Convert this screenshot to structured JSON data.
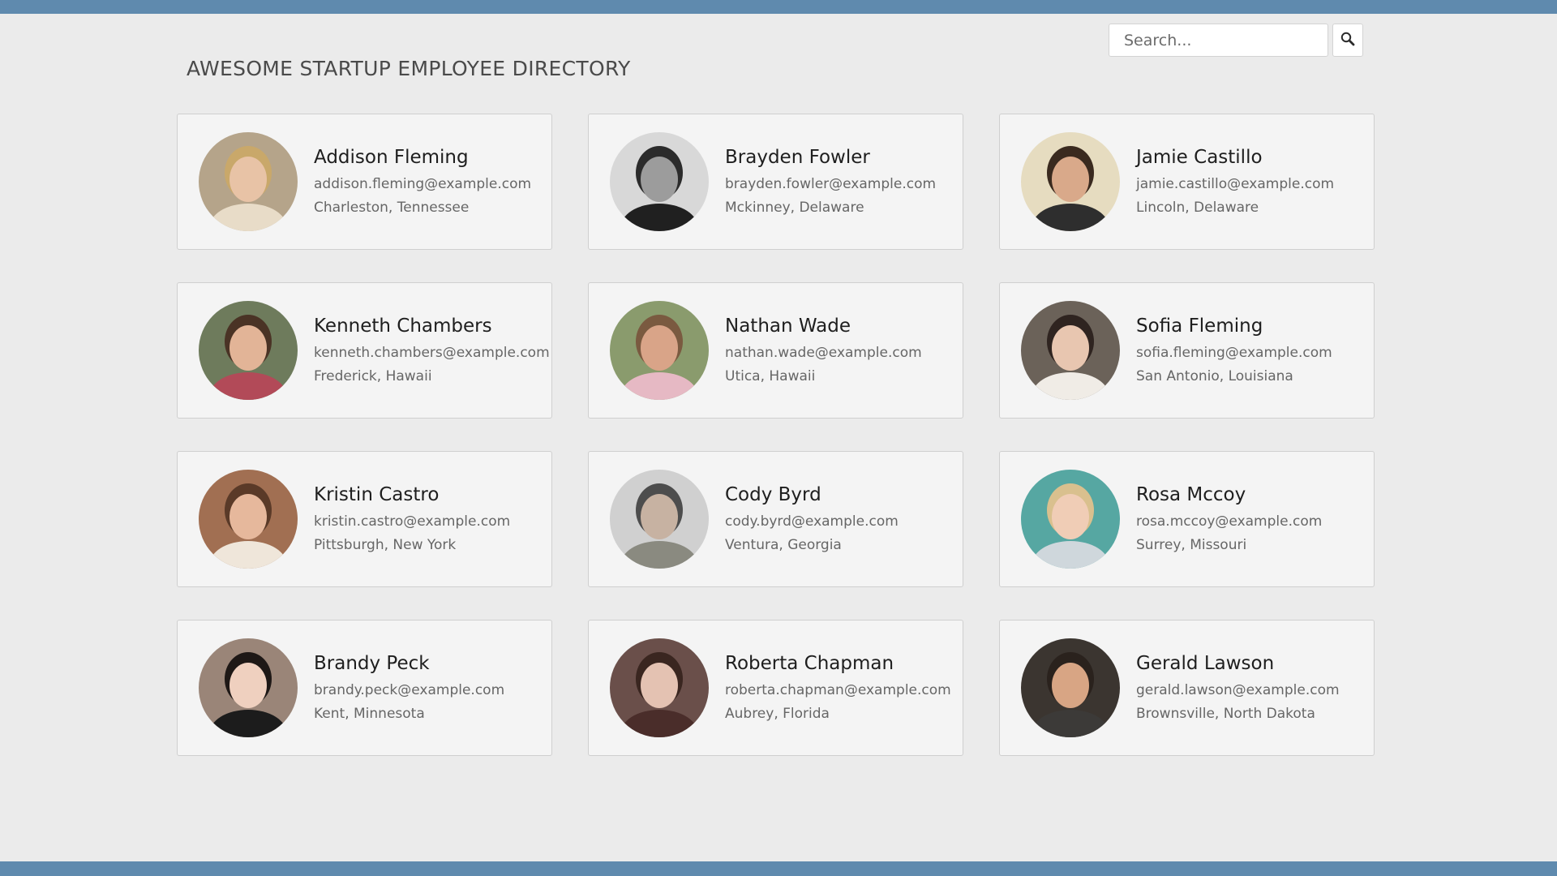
{
  "header": {
    "title": "AWESOME STARTUP EMPLOYEE DIRECTORY"
  },
  "search": {
    "placeholder": "Search...",
    "value": "",
    "button_icon": "search-icon"
  },
  "colors": {
    "frame_bar": "#5f8aae",
    "page_background": "#ebebeb",
    "card_background": "#f4f4f4"
  },
  "employees": [
    {
      "name": "Addison Fleming",
      "email": "addison.fleming@example.com",
      "location": "Charleston, Tennessee",
      "photo": "avatar-photo"
    },
    {
      "name": "Brayden Fowler",
      "email": "brayden.fowler@example.com",
      "location": "Mckinney, Delaware",
      "photo": "avatar-photo"
    },
    {
      "name": "Jamie Castillo",
      "email": "jamie.castillo@example.com",
      "location": "Lincoln, Delaware",
      "photo": "avatar-photo"
    },
    {
      "name": "Kenneth Chambers",
      "email": "kenneth.chambers@example.com",
      "location": "Frederick, Hawaii",
      "photo": "avatar-photo"
    },
    {
      "name": "Nathan Wade",
      "email": "nathan.wade@example.com",
      "location": "Utica, Hawaii",
      "photo": "avatar-photo"
    },
    {
      "name": "Sofia Fleming",
      "email": "sofia.fleming@example.com",
      "location": "San Antonio, Louisiana",
      "photo": "avatar-photo"
    },
    {
      "name": "Kristin Castro",
      "email": "kristin.castro@example.com",
      "location": "Pittsburgh, New York",
      "photo": "avatar-photo"
    },
    {
      "name": "Cody Byrd",
      "email": "cody.byrd@example.com",
      "location": "Ventura, Georgia",
      "photo": "avatar-photo"
    },
    {
      "name": "Rosa Mccoy",
      "email": "rosa.mccoy@example.com",
      "location": "Surrey, Missouri",
      "photo": "avatar-photo"
    },
    {
      "name": "Brandy Peck",
      "email": "brandy.peck@example.com",
      "location": "Kent, Minnesota",
      "photo": "avatar-photo"
    },
    {
      "name": "Roberta Chapman",
      "email": "roberta.chapman@example.com",
      "location": "Aubrey, Florida",
      "photo": "avatar-photo"
    },
    {
      "name": "Gerald Lawson",
      "email": "gerald.lawson@example.com",
      "location": "Brownsville, North Dakota",
      "photo": "avatar-photo"
    }
  ]
}
